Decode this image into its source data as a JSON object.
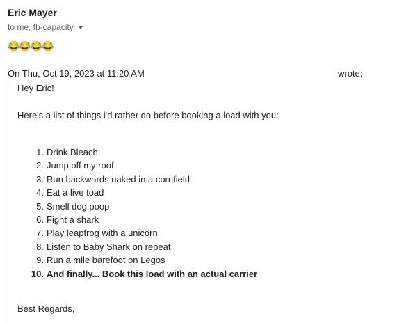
{
  "email": {
    "sender": "Eric Mayer",
    "recipients": "to me, fb-capacity",
    "emoji_line": "😂😂😂😂"
  },
  "quote": {
    "header": "On Thu, Oct 19, 2023 at 11:20 AM",
    "wrote": "wrote:",
    "greeting": "Hey Eric!",
    "intro": "Here's a list of things i'd rather do before booking a load with you:",
    "items": [
      {
        "num": "1.",
        "text": "Drink Bleach"
      },
      {
        "num": "2.",
        "text": "Jump off my roof"
      },
      {
        "num": "3.",
        "text": "Run backwards naked in a cornfield"
      },
      {
        "num": "4.",
        "text": "Eat a live toad"
      },
      {
        "num": "5.",
        "text": "Smell dog poop"
      },
      {
        "num": "6.",
        "text": "Fight a shark"
      },
      {
        "num": "7.",
        "text": "Play leapfrog with a unicorn"
      },
      {
        "num": "8.",
        "text": "Listen to Baby Shark on repeat"
      },
      {
        "num": "9.",
        "text": "Run a mile barefoot on Legos"
      },
      {
        "num": "10.",
        "text": "And finally... Book this load with an actual carrier"
      }
    ],
    "signoff": "Best Regards,"
  }
}
